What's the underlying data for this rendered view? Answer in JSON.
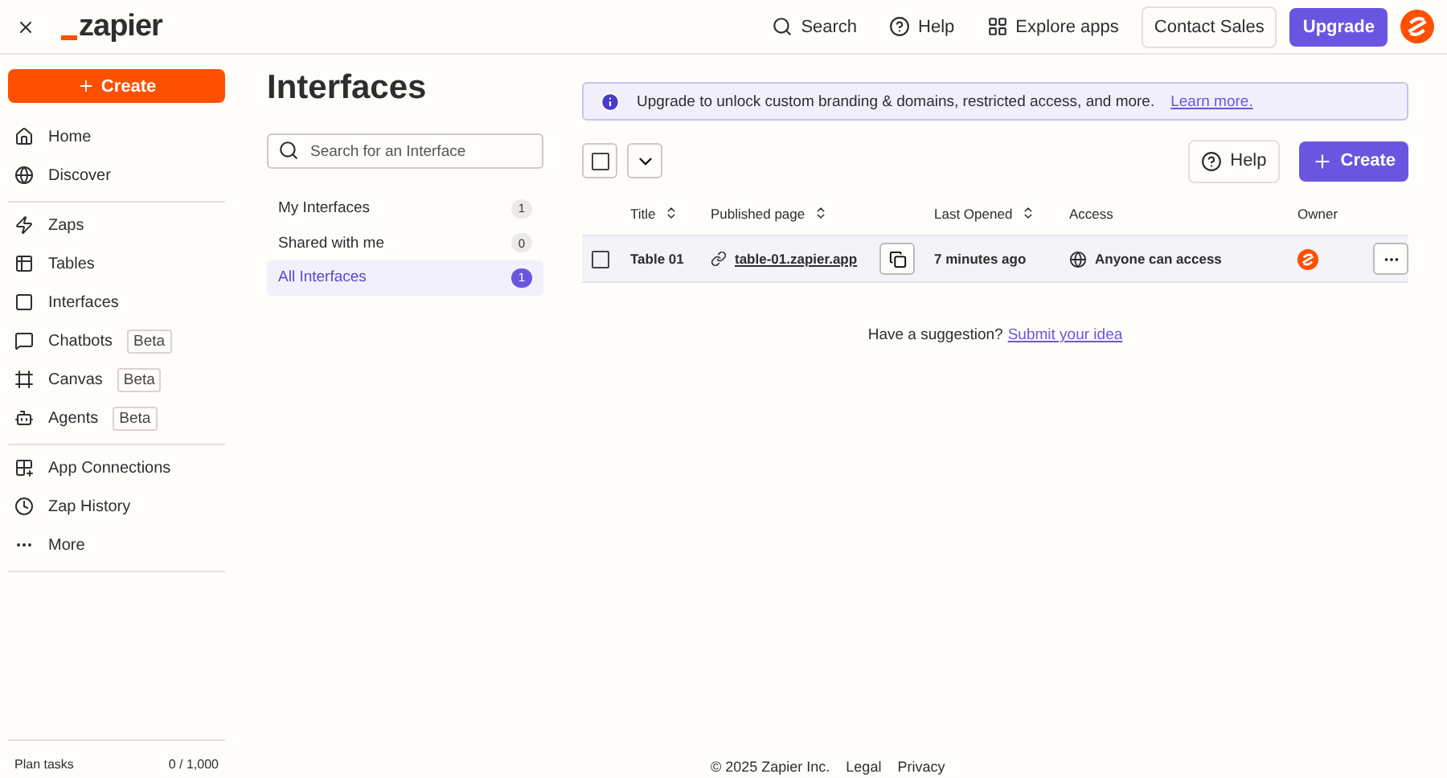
{
  "header": {
    "logo": "zapier",
    "nav": [
      {
        "kind": "search",
        "label": "Search"
      },
      {
        "kind": "help",
        "label": "Help"
      },
      {
        "kind": "apps",
        "label": "Explore apps"
      }
    ],
    "contact_button": "Contact Sales",
    "upgrade_button": "Upgrade"
  },
  "sidebar": {
    "create_button": "Create",
    "groups": [
      {
        "items": [
          {
            "label": "Home"
          },
          {
            "label": "Discover"
          }
        ]
      },
      {
        "items": [
          {
            "label": "Zaps"
          },
          {
            "label": "Tables"
          },
          {
            "label": "Interfaces"
          },
          {
            "label": "Chatbots",
            "badge": "Beta"
          },
          {
            "label": "Canvas",
            "badge": "Beta"
          },
          {
            "label": "Agents",
            "badge": "Beta"
          }
        ]
      },
      {
        "items": [
          {
            "label": "App Connections"
          },
          {
            "label": "Zap History"
          },
          {
            "label": "More"
          }
        ]
      }
    ],
    "plan": {
      "label": "Plan tasks",
      "value": "0 / 1,000"
    }
  },
  "page_title": "Interfaces",
  "search": {
    "placeholder": "Search for an Interface"
  },
  "filters": [
    {
      "label": "My Interfaces",
      "count": "1",
      "selected": false
    },
    {
      "label": "Shared with me",
      "count": "0",
      "selected": false
    },
    {
      "label": "All Interfaces",
      "count": "1",
      "selected": true
    }
  ],
  "banner": {
    "text": "Upgrade to unlock custom branding & domains, restricted access, and more.",
    "link": "Learn more."
  },
  "toolbar": {
    "select_all_checked": false,
    "help_button": "Help",
    "create_button": "Create"
  },
  "table": {
    "columns": [
      {
        "label": "Title",
        "sortable": true
      },
      {
        "label": "Published page",
        "sortable": true
      },
      {
        "label": "Last Opened",
        "sortable": true
      },
      {
        "label": "Access",
        "sortable": false
      },
      {
        "label": "Owner",
        "sortable": false
      }
    ],
    "rows": [
      {
        "checked": false,
        "title": "Table 01",
        "url": "table-01.zapier.app",
        "last_opened": "7 minutes ago",
        "access": "Anyone can access"
      }
    ]
  },
  "suggestion": {
    "text": "Have a suggestion?",
    "link": "Submit your idea"
  },
  "footer": {
    "copyright": "© 2025 Zapier Inc.",
    "links": [
      "Legal",
      "Privacy"
    ]
  }
}
